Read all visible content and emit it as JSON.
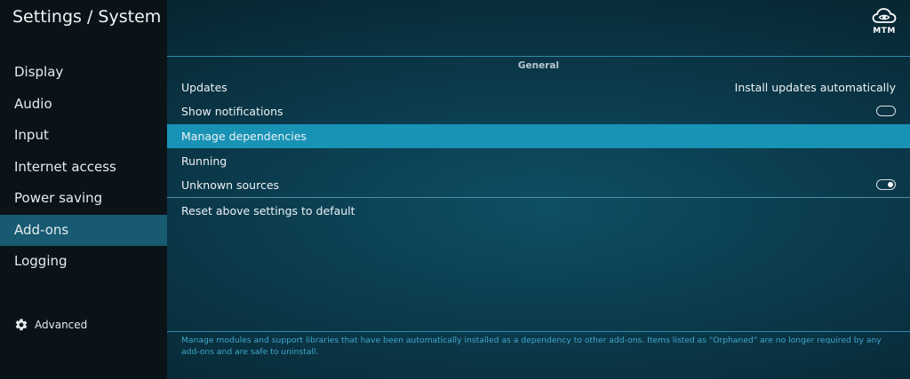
{
  "window": {
    "title": "Settings / System"
  },
  "sidebar": {
    "items": [
      {
        "label": "Display",
        "active": false
      },
      {
        "label": "Audio",
        "active": false
      },
      {
        "label": "Input",
        "active": false
      },
      {
        "label": "Internet access",
        "active": false
      },
      {
        "label": "Power saving",
        "active": false
      },
      {
        "label": "Add-ons",
        "active": true
      },
      {
        "label": "Logging",
        "active": false
      }
    ],
    "advanced": {
      "icon": "gear-icon",
      "label": "Advanced"
    }
  },
  "logo": {
    "icon": "cloud-eye-icon",
    "text": "MTM"
  },
  "main": {
    "group_header": "General",
    "settings": [
      {
        "label": "Updates",
        "value": "Install updates automatically"
      },
      {
        "label": "Show notifications",
        "toggle": false
      },
      {
        "label": "Manage dependencies",
        "focused": true
      },
      {
        "label": "Running"
      },
      {
        "label": "Unknown sources",
        "toggle": true
      }
    ],
    "reset_label": "Reset above settings to default"
  },
  "description": "Manage modules and support libraries that have been automatically installed as a dependency to other add-ons. Items listed as \"Orphaned\" are no longer required by any add-ons and are safe to uninstall.",
  "colors": {
    "accent_focus": "#1893b6",
    "active_nav": "#175a72",
    "description_text": "#3fa6cc"
  }
}
